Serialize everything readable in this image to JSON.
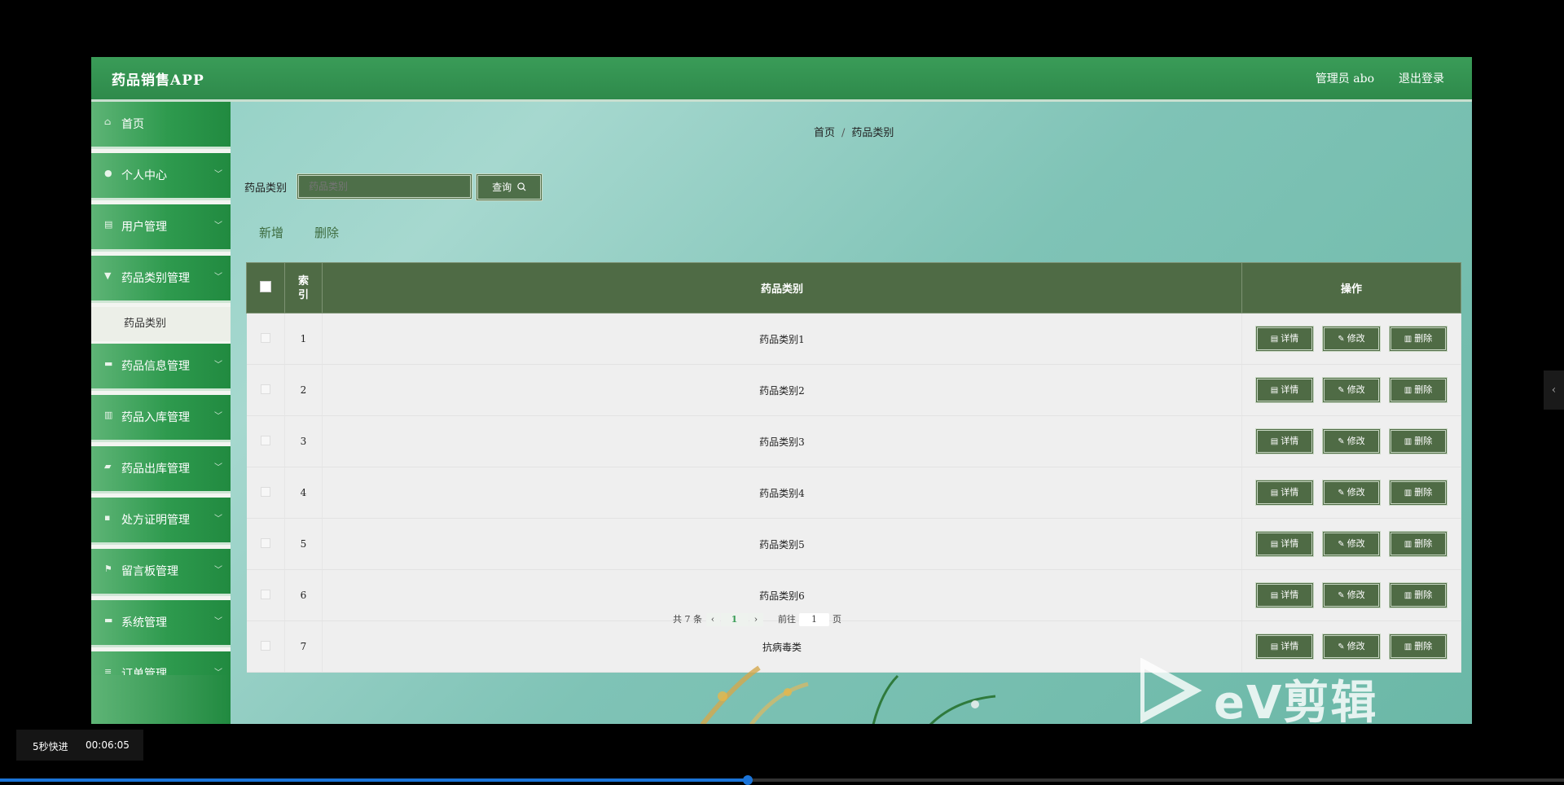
{
  "header": {
    "app_title": "药品销售APP",
    "user_label": "管理员 abo",
    "logout_label": "退出登录"
  },
  "sidebar": {
    "items": [
      {
        "label": "首页",
        "icon": "home-icon",
        "glyph": "⌂"
      },
      {
        "label": "个人中心",
        "icon": "user-icon",
        "glyph": "●"
      },
      {
        "label": "用户管理",
        "icon": "user-list-icon",
        "glyph": "▤"
      },
      {
        "label": "药品类别管理",
        "icon": "pill-icon",
        "glyph": "▼"
      },
      {
        "label": "药品信息管理",
        "icon": "box-icon",
        "glyph": "▬"
      },
      {
        "label": "药品入库管理",
        "icon": "bars-icon",
        "glyph": "▥"
      },
      {
        "label": "药品出库管理",
        "icon": "truck-icon",
        "glyph": "▰"
      },
      {
        "label": "处方证明管理",
        "icon": "document-icon",
        "glyph": "▪"
      },
      {
        "label": "留言板管理",
        "icon": "flag-icon",
        "glyph": "⚑"
      },
      {
        "label": "系统管理",
        "icon": "monitor-icon",
        "glyph": "▬"
      },
      {
        "label": "订单管理",
        "icon": "list-icon",
        "glyph": "≡"
      }
    ],
    "active_sub_item": "药品类别"
  },
  "breadcrumb": {
    "home": "首页",
    "separator": "/",
    "current": "药品类别"
  },
  "search": {
    "label": "药品类别",
    "placeholder": "药品类别",
    "button_label": "查询",
    "button_icon": "search-icon"
  },
  "actions": {
    "add_label": "新增",
    "delete_label": "删除"
  },
  "table": {
    "headers": {
      "index": "索引",
      "category": "药品类别",
      "operations": "操作"
    },
    "buttons": {
      "detail": "详情",
      "edit": "修改",
      "delete": "删除"
    },
    "rows": [
      {
        "index": "1",
        "category": "药品类别1"
      },
      {
        "index": "2",
        "category": "药品类别2"
      },
      {
        "index": "3",
        "category": "药品类别3"
      },
      {
        "index": "4",
        "category": "药品类别4"
      },
      {
        "index": "5",
        "category": "药品类别5"
      },
      {
        "index": "6",
        "category": "药品类别6"
      },
      {
        "index": "7",
        "category": "抗病毒类"
      }
    ]
  },
  "pagination": {
    "total_text": "共 7 条",
    "current_page": "1",
    "goto_label": "前往",
    "goto_value": "1",
    "page_suffix": "页"
  },
  "watermark": {
    "text": "eV剪辑"
  },
  "video_overlay": {
    "speed_label": "5秒快进",
    "timestamp": "00:06:05",
    "progress_fraction": 0.478
  },
  "colors": {
    "header_green": "#3a9c58",
    "table_header": "#4f6b45",
    "button_bg": "#4f6b45",
    "progress_blue": "#1b74d8"
  }
}
